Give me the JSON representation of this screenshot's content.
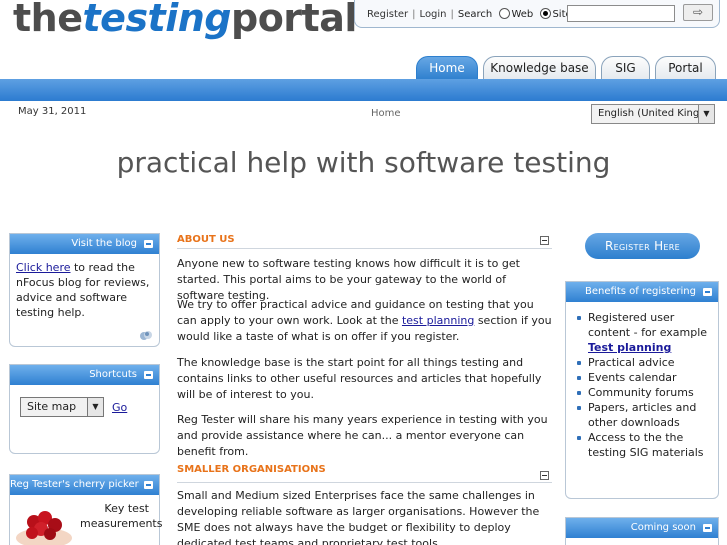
{
  "logo": {
    "part1": "the",
    "part2": "testing",
    "part3": "portal"
  },
  "topbar": {
    "register": "Register",
    "login": "Login",
    "search": "Search",
    "sep": "|",
    "radio_web": "Web",
    "radio_site": "Site",
    "search_value": "",
    "go_glyph": "⇨"
  },
  "tabs": [
    {
      "label": "Home",
      "active": true
    },
    {
      "label": "Knowledge base"
    },
    {
      "label": "SIG"
    },
    {
      "label": "Portal"
    }
  ],
  "date": "May 31, 2011",
  "breadcrumb": "Home",
  "language": {
    "selected": "English (United Kingd",
    "arrow": "▼"
  },
  "tagline": "practical help with software testing",
  "left": {
    "blog": {
      "title": "Visit the blog",
      "link": "Click here",
      "text": " to read the nFocus blog for reviews, advice and software testing help."
    },
    "shortcuts": {
      "title": "Shortcuts",
      "select": "Site map",
      "arrow": "▼",
      "go": "Go"
    },
    "cherry": {
      "title": "Reg Tester's cherry picker",
      "text": "Key test measurements"
    }
  },
  "main": {
    "about": {
      "title": "ABOUT US",
      "p1": "Anyone new to software testing knows how difficult it is to get started. This portal aims to be your gateway to the world of software testing.",
      "p2_before": "We try to offer practical advice and guidance on testing that you can apply to your own work. Look at the ",
      "p2_link": "test planning",
      "p2_after": " section if you would like a taste of what is on offer if you register.",
      "p3": "The knowledge base is the start point for all things testing and contains links to other useful resources and articles that hopefully will be of interest to you.",
      "p4": "Reg Tester will share his many years experience in testing with you and provide assistance where he can... a mentor everyone can benefit from."
    },
    "smaller": {
      "title": "SMALLER ORGANISATIONS",
      "p1": "Small and Medium sized Enterprises face the same challenges in developing reliable software as larger organisations. However the SME does not always have the budget or flexibility to deploy dedicated test teams and proprietary test tools."
    }
  },
  "right": {
    "register_button": "Register Here",
    "benefits": {
      "title": "Benefits of registering",
      "item1": "Registered user content - for example",
      "item1_link": "Test planning",
      "item2": "Practical advice",
      "item3": "Events calendar",
      "item4": "Community forums",
      "item5": "Papers, articles and other downloads",
      "item6": "Access to the the testing SIG materials"
    },
    "coming_soon": {
      "title": "Coming soon"
    }
  },
  "colors": {
    "accent_blue": "#2f80d1",
    "section_orange": "#e8731a",
    "logo_gray": "#4d4d4d",
    "logo_blue": "#1b73c7"
  },
  "icons": [
    "collapse-icon",
    "rss-feed-icon",
    "arrow-go-icon",
    "dropdown-arrow-icon"
  ]
}
